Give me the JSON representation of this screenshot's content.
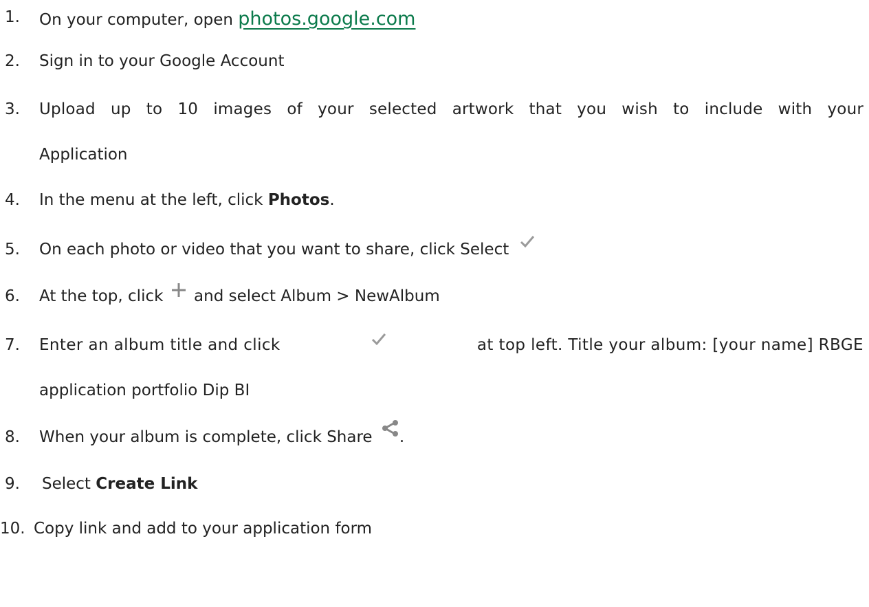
{
  "steps": [
    {
      "num": "1.",
      "text_before": "On your computer, open",
      "link": "photos.google.com"
    },
    {
      "num": "2.",
      "text": "Sign in to your Google Account"
    },
    {
      "num": "3.",
      "line1": "Upload up to 10 images of your selected artwork that you wish to include with your",
      "line2": "Application"
    },
    {
      "num": "4.",
      "text_before": "In the menu at the left, click",
      "bold": "Photos",
      "text_after": "."
    },
    {
      "num": "5.",
      "text_before": "On each photo or video that you want to share, click Select",
      "icon": "check-icon"
    },
    {
      "num": "6.",
      "text_before": "At the top, click",
      "icon": "plus-icon",
      "text_after": "and select Album > NewAlbum"
    },
    {
      "num": "7.",
      "line1_before": "Enter an album title and click",
      "icon": "check-icon",
      "line1_after": "at top left. Title your album: [your name] RBGE",
      "line2": "application portfolio Dip BI"
    },
    {
      "num": "8.",
      "text_before": "When your album is complete, click Share",
      "icon": "share-icon",
      "text_after": "."
    },
    {
      "num": "9.",
      "text_before": "Select",
      "bold": "Create Link"
    },
    {
      "num": "10.",
      "text": "Copy link and add to your application form"
    }
  ],
  "colors": {
    "text": "#222222",
    "link": "#0b7a4b",
    "icon": "#9a9a9a"
  }
}
